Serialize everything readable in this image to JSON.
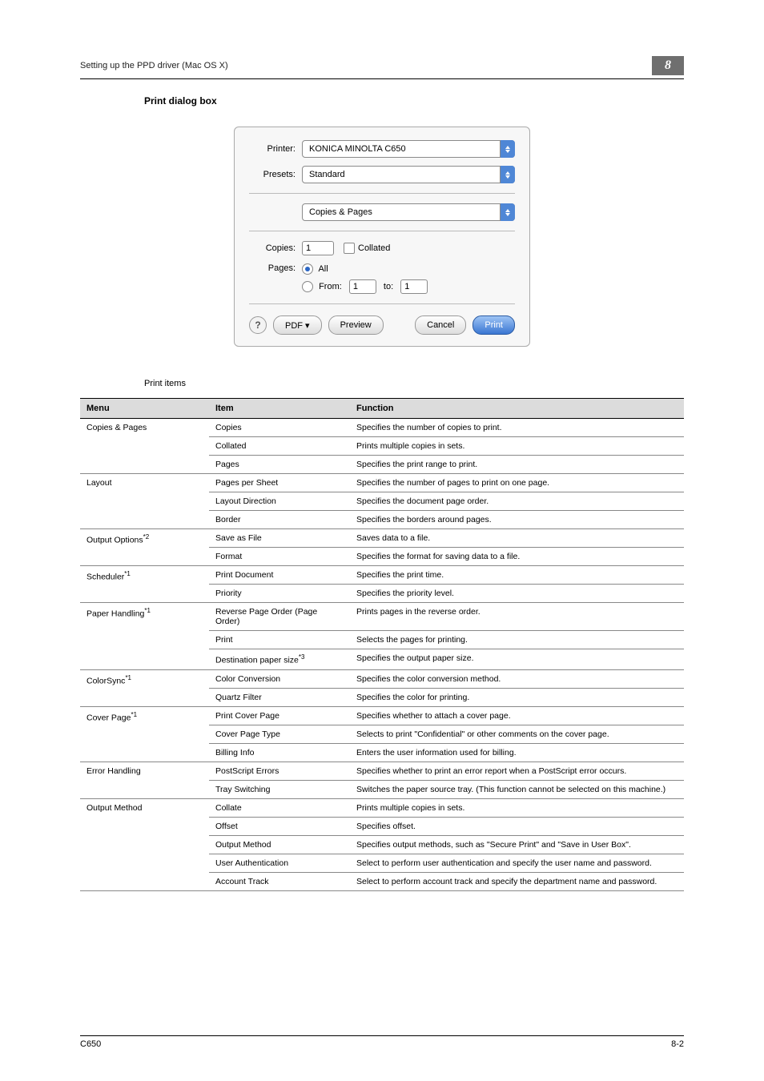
{
  "header": {
    "left": "Setting up the PPD driver (Mac OS X)",
    "right": "8"
  },
  "section_title": "Print dialog box",
  "dialog": {
    "printer_label": "Printer:",
    "printer_value": "KONICA MINOLTA C650",
    "presets_label": "Presets:",
    "presets_value": "Standard",
    "panel_value": "Copies & Pages",
    "copies_label": "Copies:",
    "copies_value": "1",
    "collated_label": "Collated",
    "pages_label": "Pages:",
    "all_label": "All",
    "from_label": "From:",
    "from_value": "1",
    "to_label": "to:",
    "to_value": "1",
    "help": "?",
    "pdf": "PDF ▾",
    "preview": "Preview",
    "cancel": "Cancel",
    "print": "Print"
  },
  "print_items_caption": "Print items",
  "th": {
    "menu": "Menu",
    "item": "Item",
    "func": "Function"
  },
  "rows": [
    {
      "m": "Copies & Pages",
      "i": "Copies",
      "f": "Specifies the number of copies to print."
    },
    {
      "m": "",
      "i": "Collated",
      "f": "Prints multiple copies in sets."
    },
    {
      "m": "",
      "i": "Pages",
      "f": "Specifies the print range to print."
    },
    {
      "m": "Layout",
      "i": "Pages per Sheet",
      "f": "Specifies the number of pages to print on one page."
    },
    {
      "m": "",
      "i": "Layout Direction",
      "f": "Specifies the document page order."
    },
    {
      "m": "",
      "i": "Border",
      "f": "Specifies the borders around pages."
    },
    {
      "m": "Output Options*2",
      "i": "Save as File",
      "f": "Saves data to a file."
    },
    {
      "m": "",
      "i": "Format",
      "f": "Specifies the format for saving data to a file."
    },
    {
      "m": "Scheduler*1",
      "i": "Print Document",
      "f": "Specifies the print time."
    },
    {
      "m": "",
      "i": "Priority",
      "f": "Specifies the priority level."
    },
    {
      "m": "Paper Handling*1",
      "i": "Reverse Page Order (Page Order)",
      "f": "Prints pages in the reverse order."
    },
    {
      "m": "",
      "i": "Print",
      "f": "Selects the pages for printing."
    },
    {
      "m": "",
      "i": "Destination paper size*3",
      "f": "Specifies the output paper size."
    },
    {
      "m": "ColorSync*1",
      "i": "Color Conversion",
      "f": "Specifies the color conversion method."
    },
    {
      "m": "",
      "i": "Quartz Filter",
      "f": "Specifies the color for printing."
    },
    {
      "m": "Cover Page*1",
      "i": "Print Cover Page",
      "f": "Specifies whether to attach a cover page."
    },
    {
      "m": "",
      "i": "Cover Page Type",
      "f": "Selects to print \"Confidential\" or other comments on the cover page."
    },
    {
      "m": "",
      "i": "Billing Info",
      "f": "Enters the user information used for billing."
    },
    {
      "m": "Error Handling",
      "i": "PostScript Errors",
      "f": "Specifies whether to print an error report when a PostScript error occurs."
    },
    {
      "m": "",
      "i": "Tray Switching",
      "f": "Switches the paper source tray. (This function cannot be selected on this machine.)"
    },
    {
      "m": "Output Method",
      "i": "Collate",
      "f": "Prints multiple copies in sets."
    },
    {
      "m": "",
      "i": "Offset",
      "f": "Specifies offset."
    },
    {
      "m": "",
      "i": "Output Method",
      "f": "Specifies output methods, such as \"Secure Print\" and \"Save in User Box\"."
    },
    {
      "m": "",
      "i": "User Authentication",
      "f": "Select to perform user authentication and specify the user name and password."
    },
    {
      "m": "",
      "i": "Account Track",
      "f": "Select to perform account track and specify the department name and password."
    }
  ],
  "footer": {
    "left": "C650",
    "right": "8-2"
  }
}
